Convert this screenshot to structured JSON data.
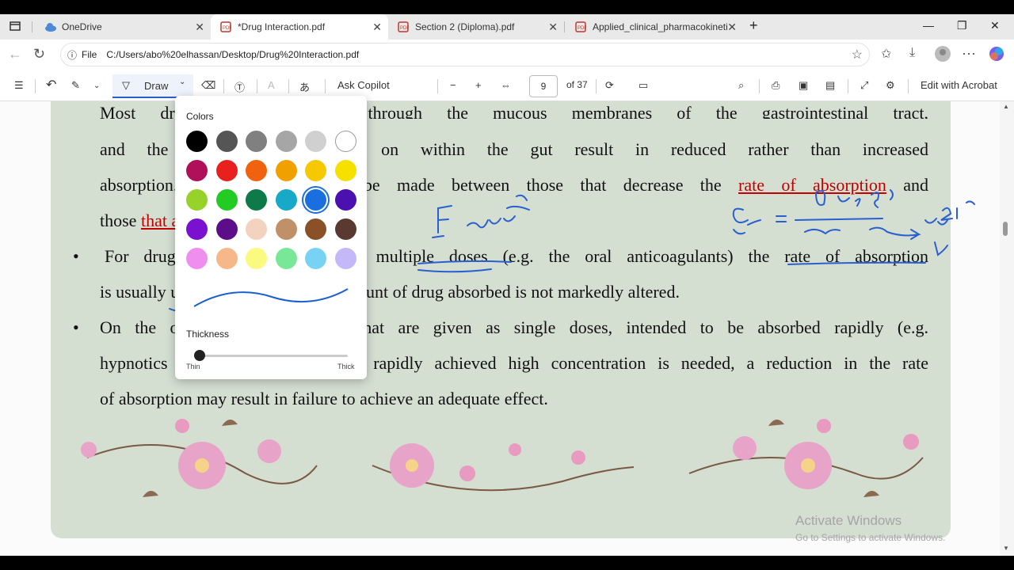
{
  "browser": {
    "tabs": [
      {
        "label": "OneDrive"
      },
      {
        "label": "*Drug Interaction.pdf"
      },
      {
        "label": "Section 2 (Diploma).pdf"
      },
      {
        "label": "Applied_clinical_pharmacokinetic"
      }
    ],
    "address": {
      "prefix": "File",
      "url": "C:/Users/abo%20elhassan/Desktop/Drug%20Interaction.pdf"
    }
  },
  "pdf_toolbar": {
    "draw_label": "Draw",
    "ask_copilot": "Ask Copilot",
    "page_number": "9",
    "page_total": "of 37",
    "edit_acrobat": "Edit with Acrobat"
  },
  "document": {
    "line1": "Most drugs are absorption through the mucous membranes of the gastrointestinal tract,",
    "line2": "and the interactions that go on within the gut result in reduced rather than increased",
    "line3_a": "absorption. A distinction must be made between those that decrease the",
    "line3_red": "rate of absorption",
    "line3_b": "and",
    "line4_a": "those",
    "line4_red": "that alter the amount absorbed",
    "line4_b": ".",
    "line5_a": "For drugs given chronically, in",
    "line5_b": "multiple doses",
    "line5_c": "(e.g. the oral anticoagulants) the",
    "line5_d": "rate of absorption",
    "line6": "is usually unimportant if the total amount of drug absorbed is not markedly altered.",
    "line7": "On the other hand, for drugs that are given as single doses, intended to be absorbed rapidly (e.g.",
    "line8": "hypnotics or analgesics), where a rapidly achieved high concentration is needed, a reduction in the rate",
    "line9": "of absorption may result in failure to achieve an adequate effect."
  },
  "draw_popup": {
    "colors_label": "Colors",
    "thickness_label": "Thickness",
    "thin_label": "Thin",
    "thick_label": "Thick",
    "swatches": [
      "#000000",
      "#555555",
      "#808080",
      "#a6a6a6",
      "#d0d0d0",
      "#ffffff",
      "#b0105a",
      "#e8201e",
      "#f0620e",
      "#f0a000",
      "#f6c800",
      "#f5e000",
      "#96d22a",
      "#22cc22",
      "#0e7a4a",
      "#18a8c8",
      "#1a6fe0",
      "#4a10b0",
      "#7a10d0",
      "#5c0e8a",
      "#f4d2c0",
      "#c09068",
      "#8a5028",
      "#5a3a30",
      "#f08ef0",
      "#f6b888",
      "#fafa80",
      "#78e898",
      "#78d2f4",
      "#c4b8f8"
    ],
    "selected_color": "#1a6fe0"
  },
  "watermark": {
    "title": "Activate Windows",
    "sub": "Go to Settings to activate Windows."
  }
}
